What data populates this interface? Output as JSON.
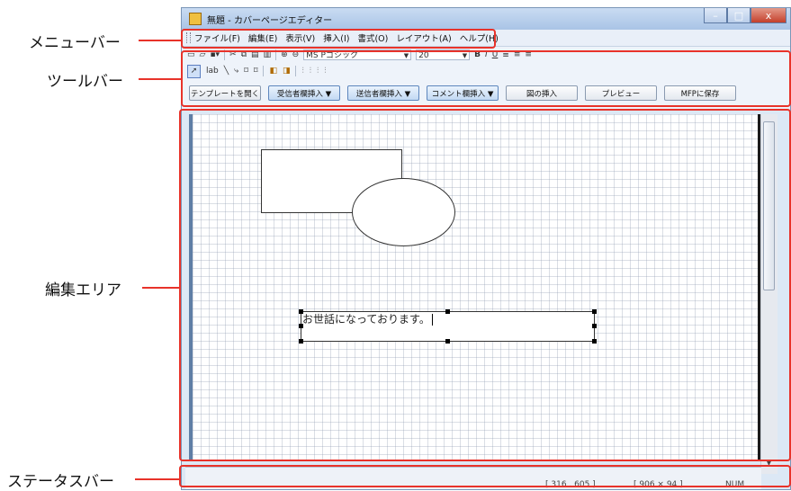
{
  "callouts": {
    "menubar": "メニューバー",
    "toolbar": "ツールバー",
    "edit_area": "編集エリア",
    "statusbar": "ステータスバー"
  },
  "window": {
    "title": "無題 - カバーページエディター",
    "minimize": "–",
    "maximize": "□",
    "close": "x"
  },
  "menu": [
    "ファイル(F)",
    "編集(E)",
    "表示(V)",
    "挿入(I)",
    "書式(O)",
    "レイアウト(A)",
    "ヘルプ(H)"
  ],
  "toolbar": {
    "font_name": "MS Pゴシック",
    "font_size": "20",
    "bold": "B",
    "italic": "I",
    "underline": "U",
    "text_tool": "lab",
    "buttons": [
      "テンプレートを開く",
      "受信者欄挿入 ▼",
      "送信者欄挿入 ▼",
      "コメント欄挿入 ▼",
      "図の挿入",
      "プレビュー",
      "MFPに保存"
    ]
  },
  "canvas": {
    "textbox_text": "お世話になっております。"
  },
  "status": {
    "position": "[ 316 , 605 ]",
    "size": "[ 906 × 94 ]",
    "num": "NUM"
  },
  "colors": {
    "callout_red": "#e8332a",
    "titlebar": "#b9d0ec",
    "active_button": "#c2d9f3"
  }
}
